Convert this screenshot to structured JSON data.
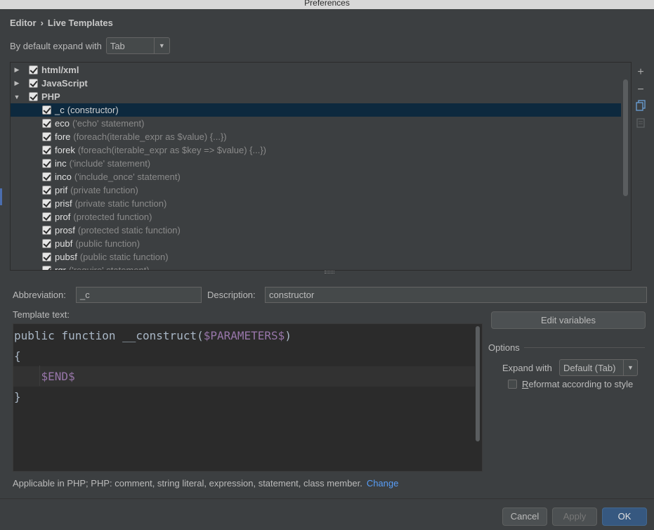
{
  "window": {
    "title": "Preferences"
  },
  "breadcrumb": {
    "parent": "Editor",
    "separator": "›",
    "current": "Live Templates"
  },
  "expand_default": {
    "label": "By default expand with",
    "value": "Tab"
  },
  "tree": {
    "groups": [
      {
        "name": "html/xml",
        "expanded": false,
        "checked": true
      },
      {
        "name": "JavaScript",
        "expanded": false,
        "checked": true
      },
      {
        "name": "PHP",
        "expanded": true,
        "checked": true
      }
    ],
    "templates": [
      {
        "abbr": "_c",
        "desc": "(constructor)",
        "selected": true
      },
      {
        "abbr": "eco",
        "desc": "('echo' statement)"
      },
      {
        "abbr": "fore",
        "desc": "(foreach(iterable_expr as $value) {...})"
      },
      {
        "abbr": "forek",
        "desc": "(foreach(iterable_expr as $key => $value) {...})"
      },
      {
        "abbr": "inc",
        "desc": "('include' statement)"
      },
      {
        "abbr": "inco",
        "desc": "('include_once' statement)"
      },
      {
        "abbr": "prif",
        "desc": "(private function)"
      },
      {
        "abbr": "prisf",
        "desc": "(private static function)"
      },
      {
        "abbr": "prof",
        "desc": "(protected function)"
      },
      {
        "abbr": "prosf",
        "desc": "(protected static function)"
      },
      {
        "abbr": "pubf",
        "desc": "(public function)"
      },
      {
        "abbr": "pubsf",
        "desc": "(public static function)"
      },
      {
        "abbr": "rqr",
        "desc": "('require' statement)"
      }
    ]
  },
  "toolbar": {
    "add_icon": "+",
    "remove_icon": "−"
  },
  "form": {
    "abbreviation_label": "Abbreviation:",
    "abbreviation_value": "_c",
    "description_label": "Description:",
    "description_value": "constructor",
    "template_text_label": "Template text:"
  },
  "code": {
    "line1_plain": "public function __construct(",
    "line1_var": "$PARAMETERS$",
    "line1_end": ")",
    "line2": "{",
    "line3_indent": "    ",
    "line3_var": "$END$",
    "line4": "}"
  },
  "buttons": {
    "edit_variables": "Edit variables",
    "cancel": "Cancel",
    "apply": "Apply",
    "ok": "OK"
  },
  "options": {
    "title": "Options",
    "expand_with_label": "Expand with",
    "expand_with_value": "Default (Tab)",
    "reformat_label": "Reformat according to style",
    "reformat_checked": false
  },
  "applicable": {
    "text": "Applicable in PHP; PHP: comment, string literal, expression, statement, class member.",
    "change_link": "Change"
  },
  "colors": {
    "selection": "#0d293e",
    "link": "#589df6",
    "template_var": "#9876aa",
    "ok_button": "#365880"
  }
}
